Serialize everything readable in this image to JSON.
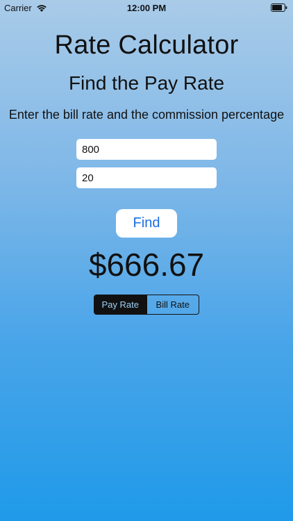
{
  "status_bar": {
    "carrier": "Carrier",
    "time": "12:00 PM",
    "wifi_icon": "wifi-icon",
    "battery_icon": "battery-icon"
  },
  "title": "Rate Calculator",
  "subtitle": "Find the Pay Rate",
  "instructions": "Enter the bill rate and the commission percentage",
  "inputs": {
    "bill_rate": {
      "value": "800"
    },
    "commission": {
      "value": "20"
    }
  },
  "find_button": {
    "label": "Find"
  },
  "result": "$666.67",
  "mode": {
    "options": [
      "Pay Rate",
      "Bill Rate"
    ],
    "selected": "Pay Rate"
  },
  "colors": {
    "background_top": "#a9cbe8",
    "background_bottom": "#1f9ae9",
    "button_text": "#1b6ee0",
    "segment_selected_bg": "#111111"
  }
}
